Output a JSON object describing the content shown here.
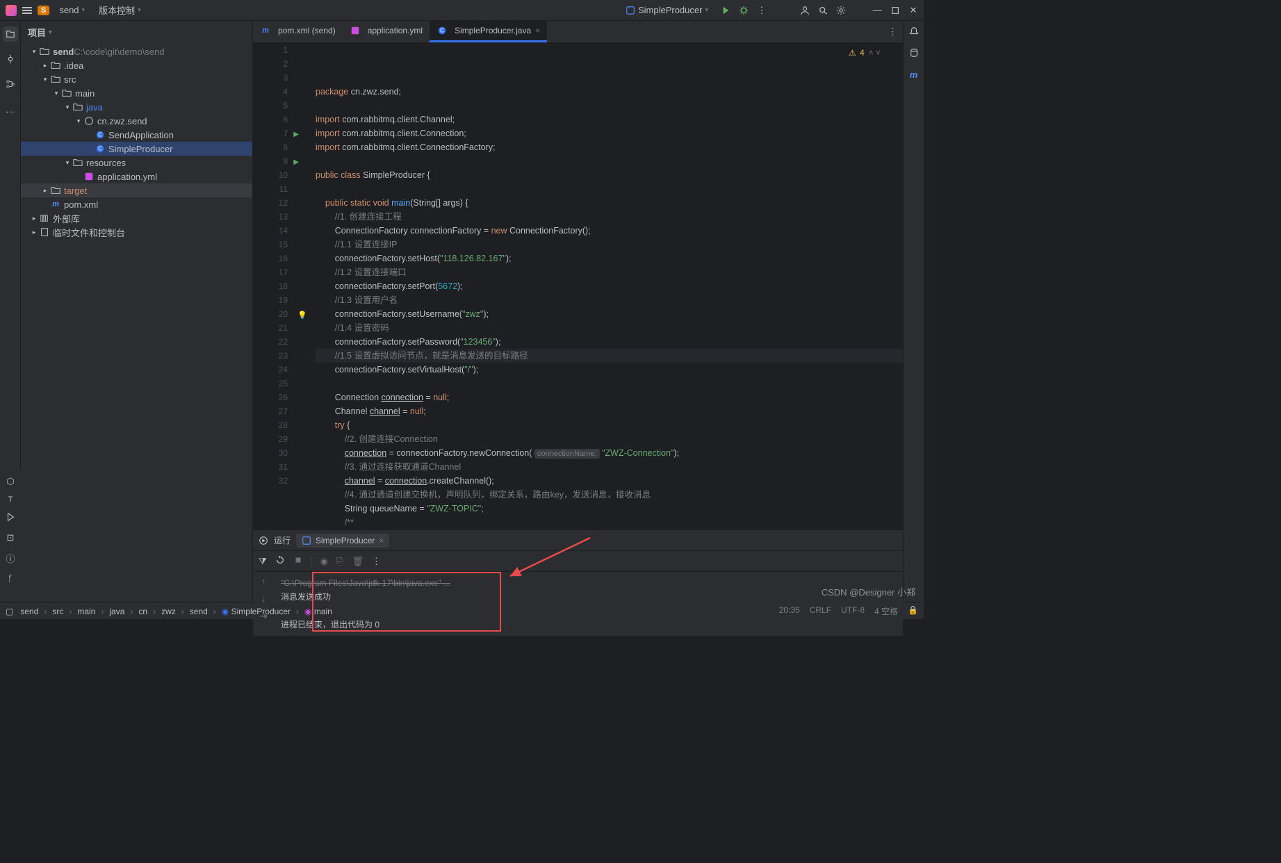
{
  "topbar": {
    "project_badge": "S",
    "project_name": "send",
    "vcs_label": "版本控制",
    "run_config": "SimpleProducer"
  },
  "project": {
    "title": "项目",
    "tree": [
      {
        "d": 0,
        "tog": "v",
        "ic": "folder",
        "label": "send",
        "suffix": " C:\\code\\git\\demo\\send",
        "suffixColor": "#7a7e85",
        "bold": true
      },
      {
        "d": 1,
        "tog": ">",
        "ic": "folder",
        "label": ".idea"
      },
      {
        "d": 1,
        "tog": "v",
        "ic": "folder",
        "label": "src"
      },
      {
        "d": 2,
        "tog": "v",
        "ic": "folder",
        "label": "main"
      },
      {
        "d": 3,
        "tog": "v",
        "ic": "folder",
        "label": "java",
        "blue": true
      },
      {
        "d": 4,
        "tog": "v",
        "ic": "pkg",
        "label": "cn.zwz.send"
      },
      {
        "d": 5,
        "tog": " ",
        "ic": "class",
        "label": "SendApplication"
      },
      {
        "d": 5,
        "tog": " ",
        "ic": "class",
        "label": "SimpleProducer",
        "sel": true
      },
      {
        "d": 3,
        "tog": "v",
        "ic": "folder",
        "label": "resources"
      },
      {
        "d": 4,
        "tog": " ",
        "ic": "yml",
        "label": "application.yml"
      },
      {
        "d": 1,
        "tog": ">",
        "ic": "folder",
        "label": "target",
        "hl": true,
        "orange": true
      },
      {
        "d": 1,
        "tog": " ",
        "ic": "maven",
        "label": "pom.xml"
      },
      {
        "d": 0,
        "tog": ">",
        "ic": "lib",
        "label": "外部库"
      },
      {
        "d": 0,
        "tog": ">",
        "ic": "scratch",
        "label": "临时文件和控制台"
      }
    ]
  },
  "tabs": [
    {
      "ic": "maven",
      "label": "pom.xml (send)",
      "active": false
    },
    {
      "ic": "yml",
      "label": "application.yml",
      "active": false
    },
    {
      "ic": "class",
      "label": "SimpleProducer.java",
      "active": true
    }
  ],
  "warn_count": "4",
  "code": [
    {
      "n": 1,
      "seg": [
        [
          "kw",
          "package "
        ],
        [
          "ident",
          "cn.zwz.send;"
        ]
      ]
    },
    {
      "n": 2,
      "seg": []
    },
    {
      "n": 3,
      "seg": [
        [
          "kw",
          "import "
        ],
        [
          "ident",
          "com.rabbitmq.client.Channel;"
        ]
      ]
    },
    {
      "n": 4,
      "seg": [
        [
          "kw",
          "import "
        ],
        [
          "ident",
          "com.rabbitmq.client.Connection;"
        ]
      ]
    },
    {
      "n": 5,
      "seg": [
        [
          "kw",
          "import "
        ],
        [
          "ident",
          "com.rabbitmq.client.ConnectionFactory;"
        ]
      ]
    },
    {
      "n": 6,
      "seg": []
    },
    {
      "n": 7,
      "run": true,
      "seg": [
        [
          "kw",
          "public class "
        ],
        [
          "ident",
          "SimpleProducer {"
        ]
      ]
    },
    {
      "n": 8,
      "seg": []
    },
    {
      "n": 9,
      "run": true,
      "seg": [
        [
          "ident",
          "    "
        ],
        [
          "kw",
          "public static void "
        ],
        [
          "fn",
          "main"
        ],
        [
          "ident",
          "(String[] args) {"
        ]
      ]
    },
    {
      "n": 10,
      "seg": [
        [
          "ident",
          "        "
        ],
        [
          "cm",
          "//1. 创建连接工程"
        ]
      ]
    },
    {
      "n": 11,
      "seg": [
        [
          "ident",
          "        ConnectionFactory connectionFactory = "
        ],
        [
          "kw",
          "new "
        ],
        [
          "ident",
          "ConnectionFactory();"
        ]
      ]
    },
    {
      "n": 12,
      "seg": [
        [
          "ident",
          "        "
        ],
        [
          "cm",
          "//1.1 设置连接IP"
        ]
      ]
    },
    {
      "n": 13,
      "seg": [
        [
          "ident",
          "        connectionFactory.setHost("
        ],
        [
          "str",
          "\"118.126.82.167\""
        ],
        [
          "ident",
          ");"
        ]
      ]
    },
    {
      "n": 14,
      "seg": [
        [
          "ident",
          "        "
        ],
        [
          "cm",
          "//1.2 设置连接端口"
        ]
      ]
    },
    {
      "n": 15,
      "seg": [
        [
          "ident",
          "        connectionFactory.setPort("
        ],
        [
          "num",
          "5672"
        ],
        [
          "ident",
          ");"
        ]
      ]
    },
    {
      "n": 16,
      "seg": [
        [
          "ident",
          "        "
        ],
        [
          "cm",
          "//1.3 设置用户名"
        ]
      ]
    },
    {
      "n": 17,
      "seg": [
        [
          "ident",
          "        connectionFactory.setUsername("
        ],
        [
          "str",
          "\"zwz\""
        ],
        [
          "ident",
          ");"
        ]
      ]
    },
    {
      "n": 18,
      "seg": [
        [
          "ident",
          "        "
        ],
        [
          "cm",
          "//1.4 设置密码"
        ]
      ]
    },
    {
      "n": 19,
      "seg": [
        [
          "ident",
          "        connectionFactory.setPassword("
        ],
        [
          "str",
          "\"123456\""
        ],
        [
          "ident",
          ");"
        ]
      ]
    },
    {
      "n": 20,
      "hl": true,
      "bulb": true,
      "seg": [
        [
          "ident",
          "        "
        ],
        [
          "cm",
          "//1.5 设置虚拟访问节点，就是消息发送的目标路径"
        ]
      ]
    },
    {
      "n": 21,
      "seg": [
        [
          "ident",
          "        connectionFactory.setVirtualHost("
        ],
        [
          "str",
          "\"/\""
        ],
        [
          "ident",
          ");"
        ]
      ]
    },
    {
      "n": 22,
      "seg": []
    },
    {
      "n": 23,
      "seg": [
        [
          "ident",
          "        Connection "
        ],
        [
          "und",
          "connection"
        ],
        [
          "ident",
          " = "
        ],
        [
          "kw",
          "null"
        ],
        [
          "ident",
          ";"
        ]
      ]
    },
    {
      "n": 24,
      "seg": [
        [
          "ident",
          "        Channel "
        ],
        [
          "und",
          "channel"
        ],
        [
          "ident",
          " = "
        ],
        [
          "kw",
          "null"
        ],
        [
          "ident",
          ";"
        ]
      ]
    },
    {
      "n": 25,
      "seg": [
        [
          "ident",
          "        "
        ],
        [
          "kw",
          "try "
        ],
        [
          "ident",
          "{"
        ]
      ]
    },
    {
      "n": 26,
      "seg": [
        [
          "ident",
          "            "
        ],
        [
          "cm",
          "//2. 创建连接Connection"
        ]
      ]
    },
    {
      "n": 27,
      "seg": [
        [
          "ident",
          "            "
        ],
        [
          "und",
          "connection"
        ],
        [
          "ident",
          " = connectionFactory.newConnection( "
        ],
        [
          "hint",
          "connectionName:"
        ],
        [
          "ident",
          " "
        ],
        [
          "str",
          "\"ZWZ-Connection\""
        ],
        [
          "ident",
          ");"
        ]
      ]
    },
    {
      "n": 28,
      "seg": [
        [
          "ident",
          "            "
        ],
        [
          "cm",
          "//3. 通过连接获取通道Channel"
        ]
      ]
    },
    {
      "n": 29,
      "seg": [
        [
          "ident",
          "            "
        ],
        [
          "und",
          "channel"
        ],
        [
          "ident",
          " = "
        ],
        [
          "und",
          "connection"
        ],
        [
          "ident",
          ".createChannel();"
        ]
      ]
    },
    {
      "n": 30,
      "seg": [
        [
          "ident",
          "            "
        ],
        [
          "cm",
          "//4. 通过通道创建交换机，声明队列，绑定关系，路由key，发送消息，接收消息"
        ]
      ]
    },
    {
      "n": 31,
      "seg": [
        [
          "ident",
          "            String queueName = "
        ],
        [
          "str",
          "\"ZWZ-TOPIC\""
        ],
        [
          "ident",
          ";"
        ]
      ]
    },
    {
      "n": 32,
      "seg": [
        [
          "ident",
          "            "
        ],
        [
          "cm",
          "/**"
        ]
      ]
    }
  ],
  "run": {
    "label": "运行",
    "tab": "SimpleProducer",
    "lines": [
      {
        "cls": "gray",
        "txt": "\"C:\\Program Files\\Java\\jdk-17\\bin\\java.exe\" ..."
      },
      {
        "cls": "",
        "txt": "消息发送成功"
      },
      {
        "cls": "",
        "txt": ""
      },
      {
        "cls": "",
        "txt": "进程已结束，退出代码为 0"
      }
    ]
  },
  "breadcrumbs": [
    "send",
    "src",
    "main",
    "java",
    "cn",
    "zwz",
    "send",
    "SimpleProducer",
    "main"
  ],
  "status": {
    "pos": "20:35",
    "crlf": "CRLF",
    "enc": "UTF-8",
    "indent": "4 空格"
  },
  "watermark": "CSDN @Designer 小郑"
}
